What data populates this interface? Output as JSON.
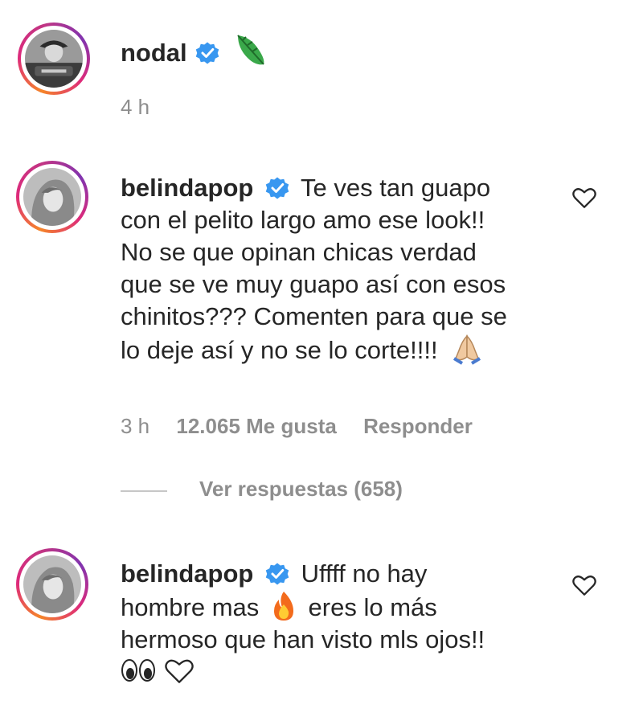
{
  "post_header": {
    "username": "nodal",
    "time": "4 h",
    "emoji": "leaf-emoji"
  },
  "comments": [
    {
      "username": "belindapop",
      "text_lines": [
        "Te ves tan guapo",
        "con el pelito largo amo ese look!!",
        "No se que opinan chicas verdad",
        "que se ve muy guapo así con esos",
        "chinitos??? Comenten para que se",
        "lo deje así y no se lo corte!!!!"
      ],
      "emoji": "folded-hands-emoji",
      "time": "3 h",
      "likes": "12.065 Me gusta",
      "reply": "Responder",
      "view_replies": "Ver respuestas (658)"
    },
    {
      "username": "belindapop",
      "text_lines": [
        "Uffff no hay",
        "hombre mas",
        "eres lo más",
        "hermoso que han visto mls ojos!!"
      ],
      "emojis": [
        "fire-emoji",
        "eyes-emoji",
        "white-heart-emoji"
      ]
    }
  ],
  "colors": {
    "verified_blue": "#3897f0",
    "meta_gray": "#8e8e8e",
    "text": "#262626"
  }
}
